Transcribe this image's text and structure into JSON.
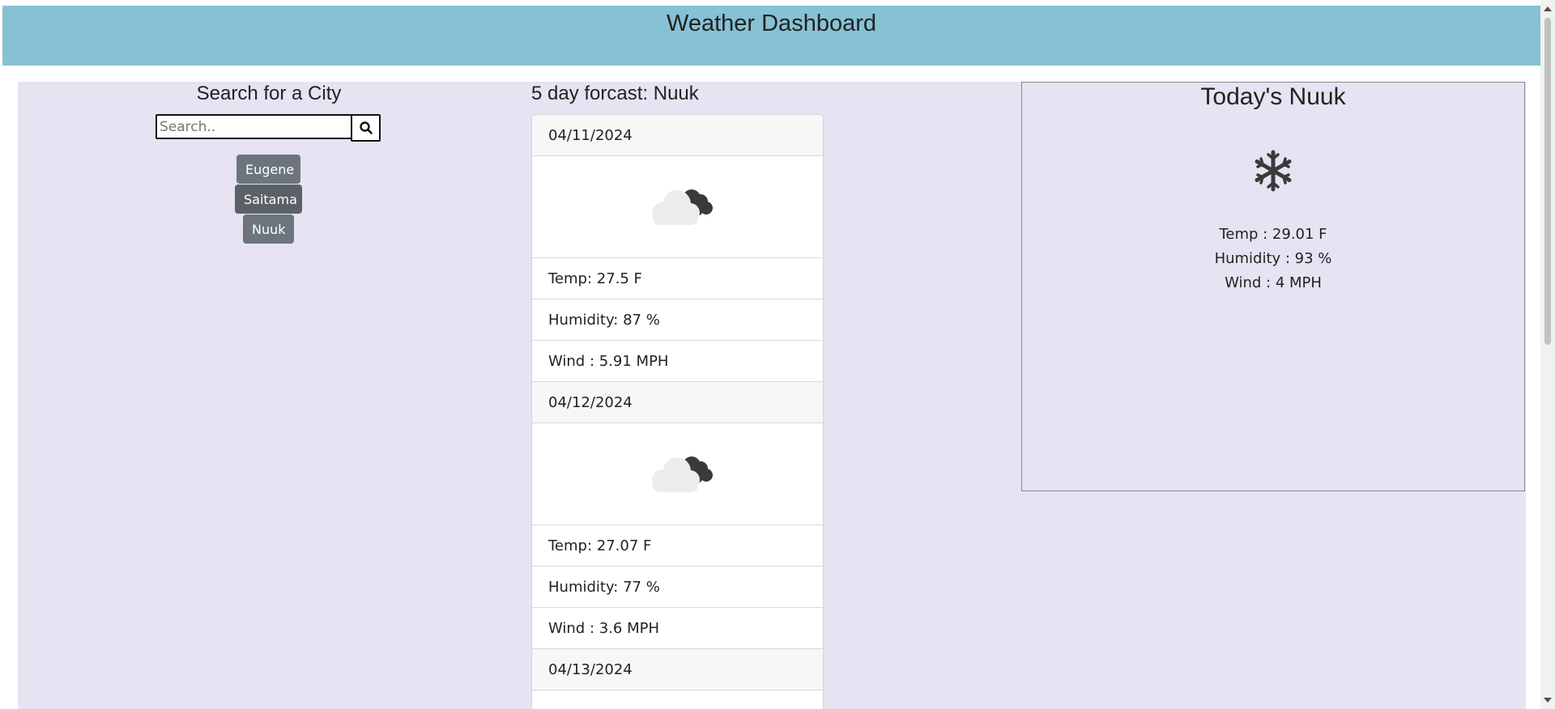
{
  "header": {
    "title": "Weather Dashboard"
  },
  "search": {
    "title": "Search for a City",
    "placeholder": "Search..",
    "button_icon": "search-icon",
    "history": [
      {
        "label": "Eugene"
      },
      {
        "label": "Saitama"
      },
      {
        "label": "Nuuk"
      }
    ]
  },
  "forecast": {
    "title": "5 day forcast: Nuuk",
    "days": [
      {
        "date": "04/11/2024",
        "icon": "cloudy-night-icon",
        "temp": "Temp: 27.5 F",
        "humidity": "Humidity: 87 %",
        "wind": "Wind : 5.91 MPH"
      },
      {
        "date": "04/12/2024",
        "icon": "cloudy-night-icon",
        "temp": "Temp: 27.07 F",
        "humidity": "Humidity: 77 %",
        "wind": "Wind : 3.6 MPH"
      },
      {
        "date": "04/13/2024"
      }
    ]
  },
  "today": {
    "title": "Today's Nuuk",
    "icon": "snowflake-icon",
    "temp": "Temp : 29.01 F",
    "humidity": "Humidity : 93 %",
    "wind": "Wind : 4 MPH"
  },
  "colors": {
    "header_bg": "#87c1d4",
    "main_bg": "#e7e3f2",
    "city_button_bg": "#6c757d"
  }
}
